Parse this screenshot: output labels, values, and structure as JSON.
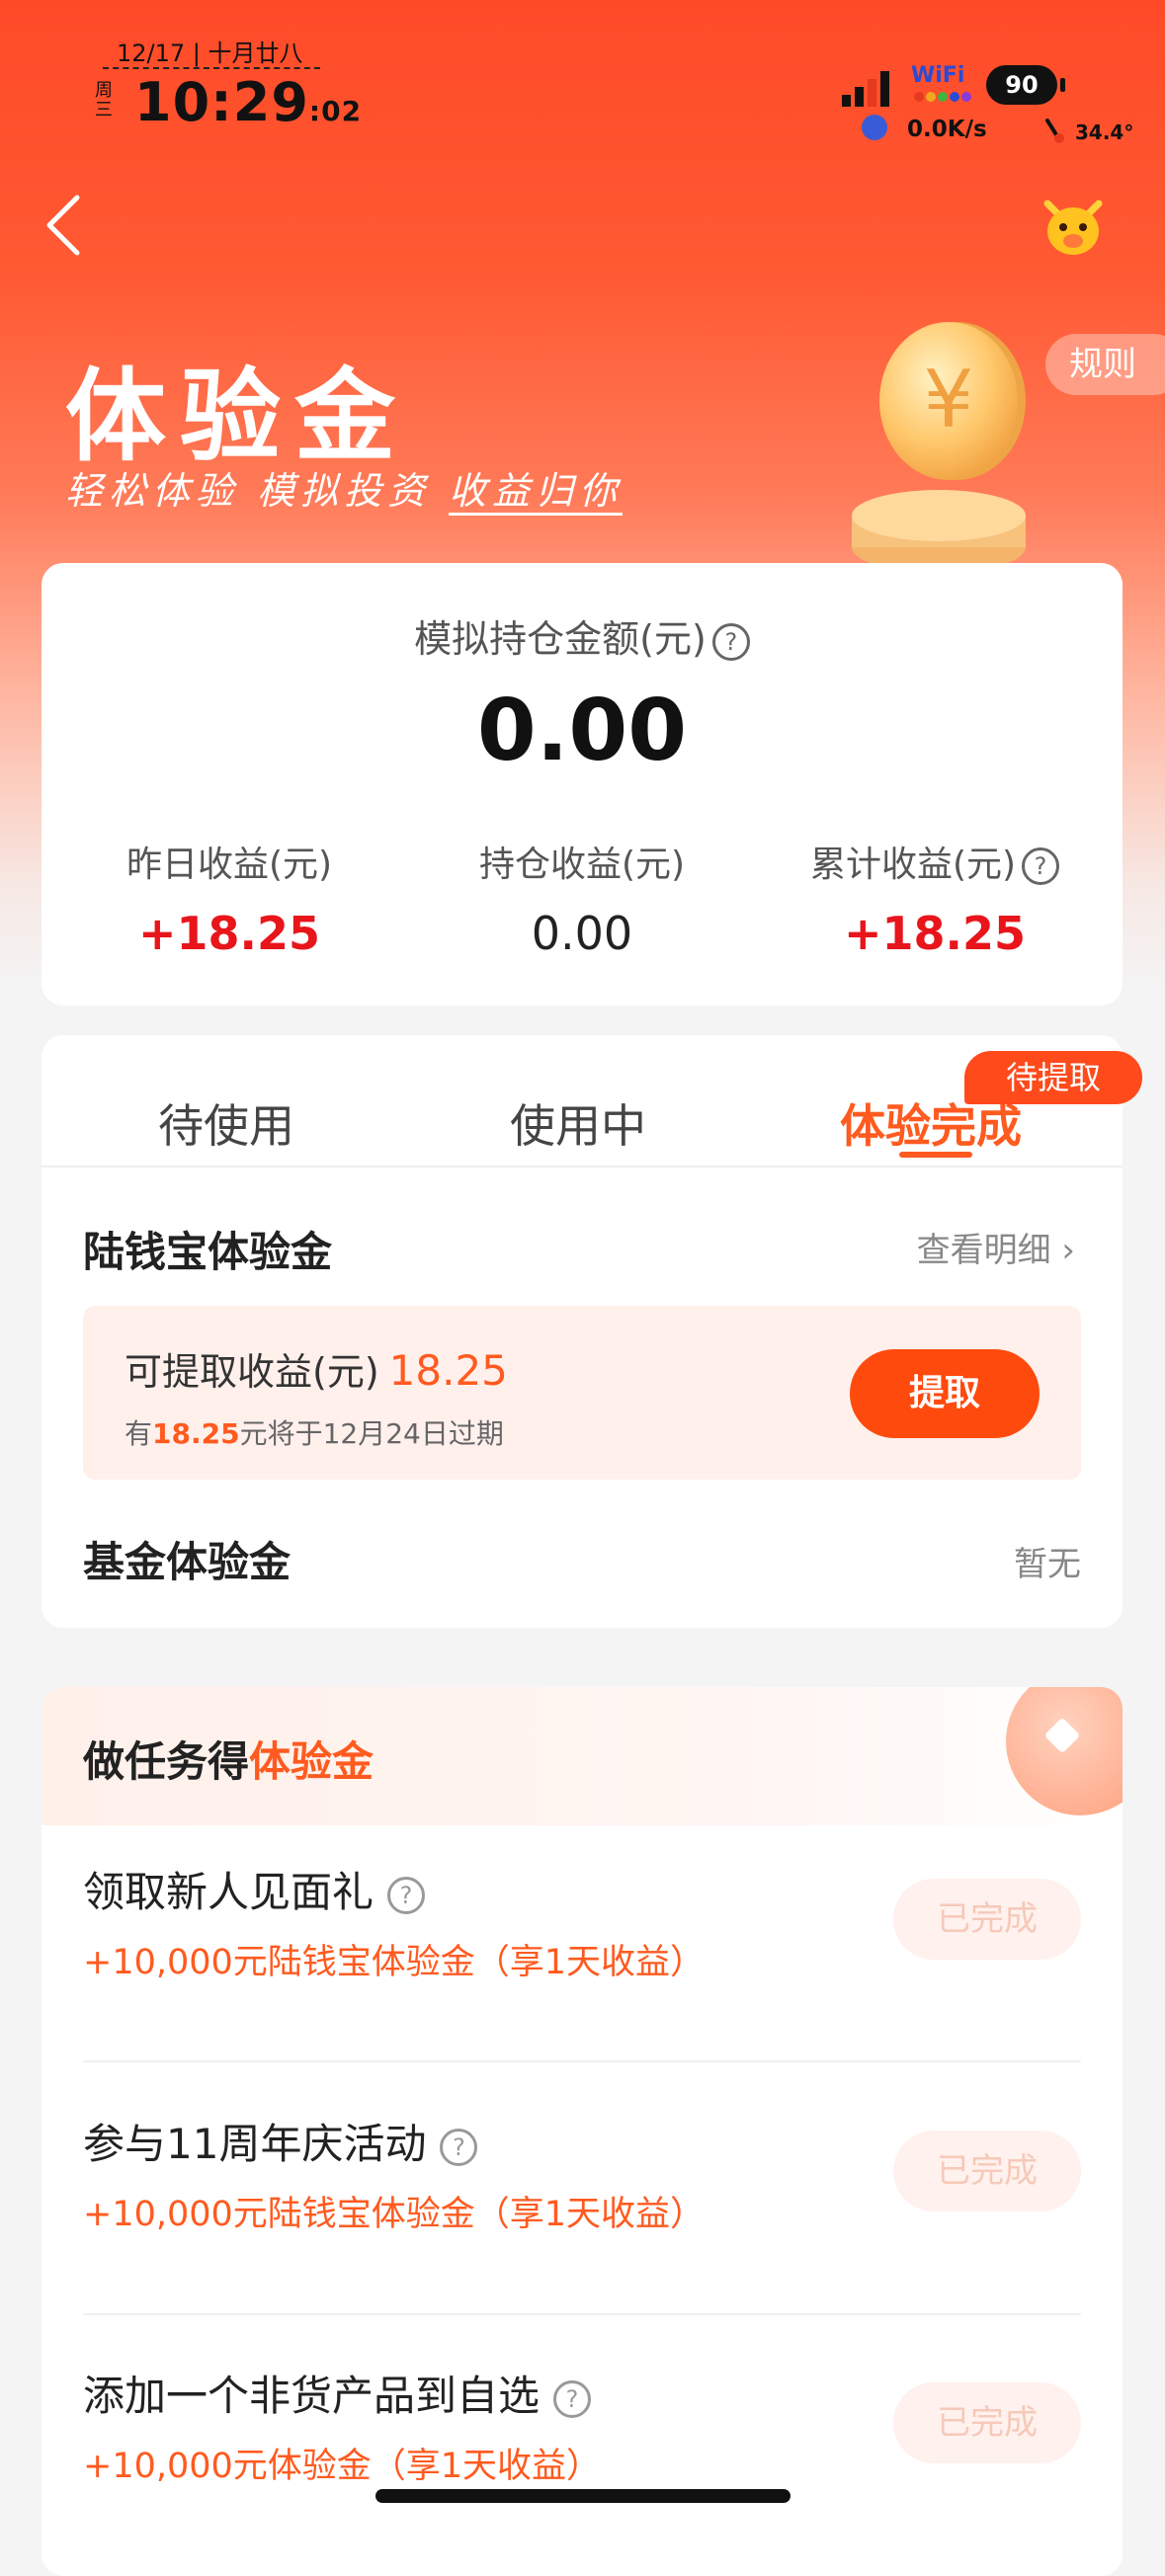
{
  "status_bar": {
    "date": "12/17 | 十月廿八",
    "weekday": "周三",
    "time": "10:29",
    "seconds": ":02",
    "wifi": "WiFi",
    "battery": "90",
    "net_speed": "0.0K/s",
    "temperature": "34.4°"
  },
  "header": {
    "title": "体验金",
    "subtitle_a": "轻松体验 模拟投资 ",
    "subtitle_b": "收益归你",
    "rules_label": "规则"
  },
  "summary": {
    "holding_label": "模拟持仓金额(元)",
    "holding_amount": "0.00",
    "help_glyph": "?",
    "stats": [
      {
        "label": "昨日收益(元)",
        "value": "+18.25"
      },
      {
        "label": "持仓收益(元)",
        "value": "0.00"
      },
      {
        "label": "累计收益(元)",
        "value": "+18.25"
      }
    ]
  },
  "tabs": {
    "items": [
      "待使用",
      "使用中",
      "体验完成"
    ],
    "active_index": 2,
    "badge": "待提取"
  },
  "experience": {
    "lqb_title": "陆钱宝体验金",
    "view_detail": "查看明细",
    "withdraw_label": "可提取收益(元)",
    "withdraw_amount": "18.25",
    "note_prefix": "有",
    "note_amount": "18.25",
    "note_suffix": "元将于12月24日过期",
    "withdraw_button": "提取",
    "fund_title": "基金体验金",
    "fund_status": "暂无"
  },
  "tasks": {
    "title_prefix": "做任务得",
    "title_highlight": "体验金",
    "items": [
      {
        "name": "领取新人见面礼",
        "reward": "+10,000元陆钱宝体验金（享1天收益）",
        "status": "已完成"
      },
      {
        "name": "参与11周年庆活动",
        "reward": "+10,000元陆钱宝体验金（享1天收益）",
        "status": "已完成"
      },
      {
        "name": "添加一个非货产品到自选",
        "reward": "+10,000元体验金（享1天收益）",
        "status": "已完成"
      }
    ]
  },
  "colors": {
    "brand": "#ff4a28",
    "accent": "#ff5a1f",
    "gain": "#e8151b"
  }
}
